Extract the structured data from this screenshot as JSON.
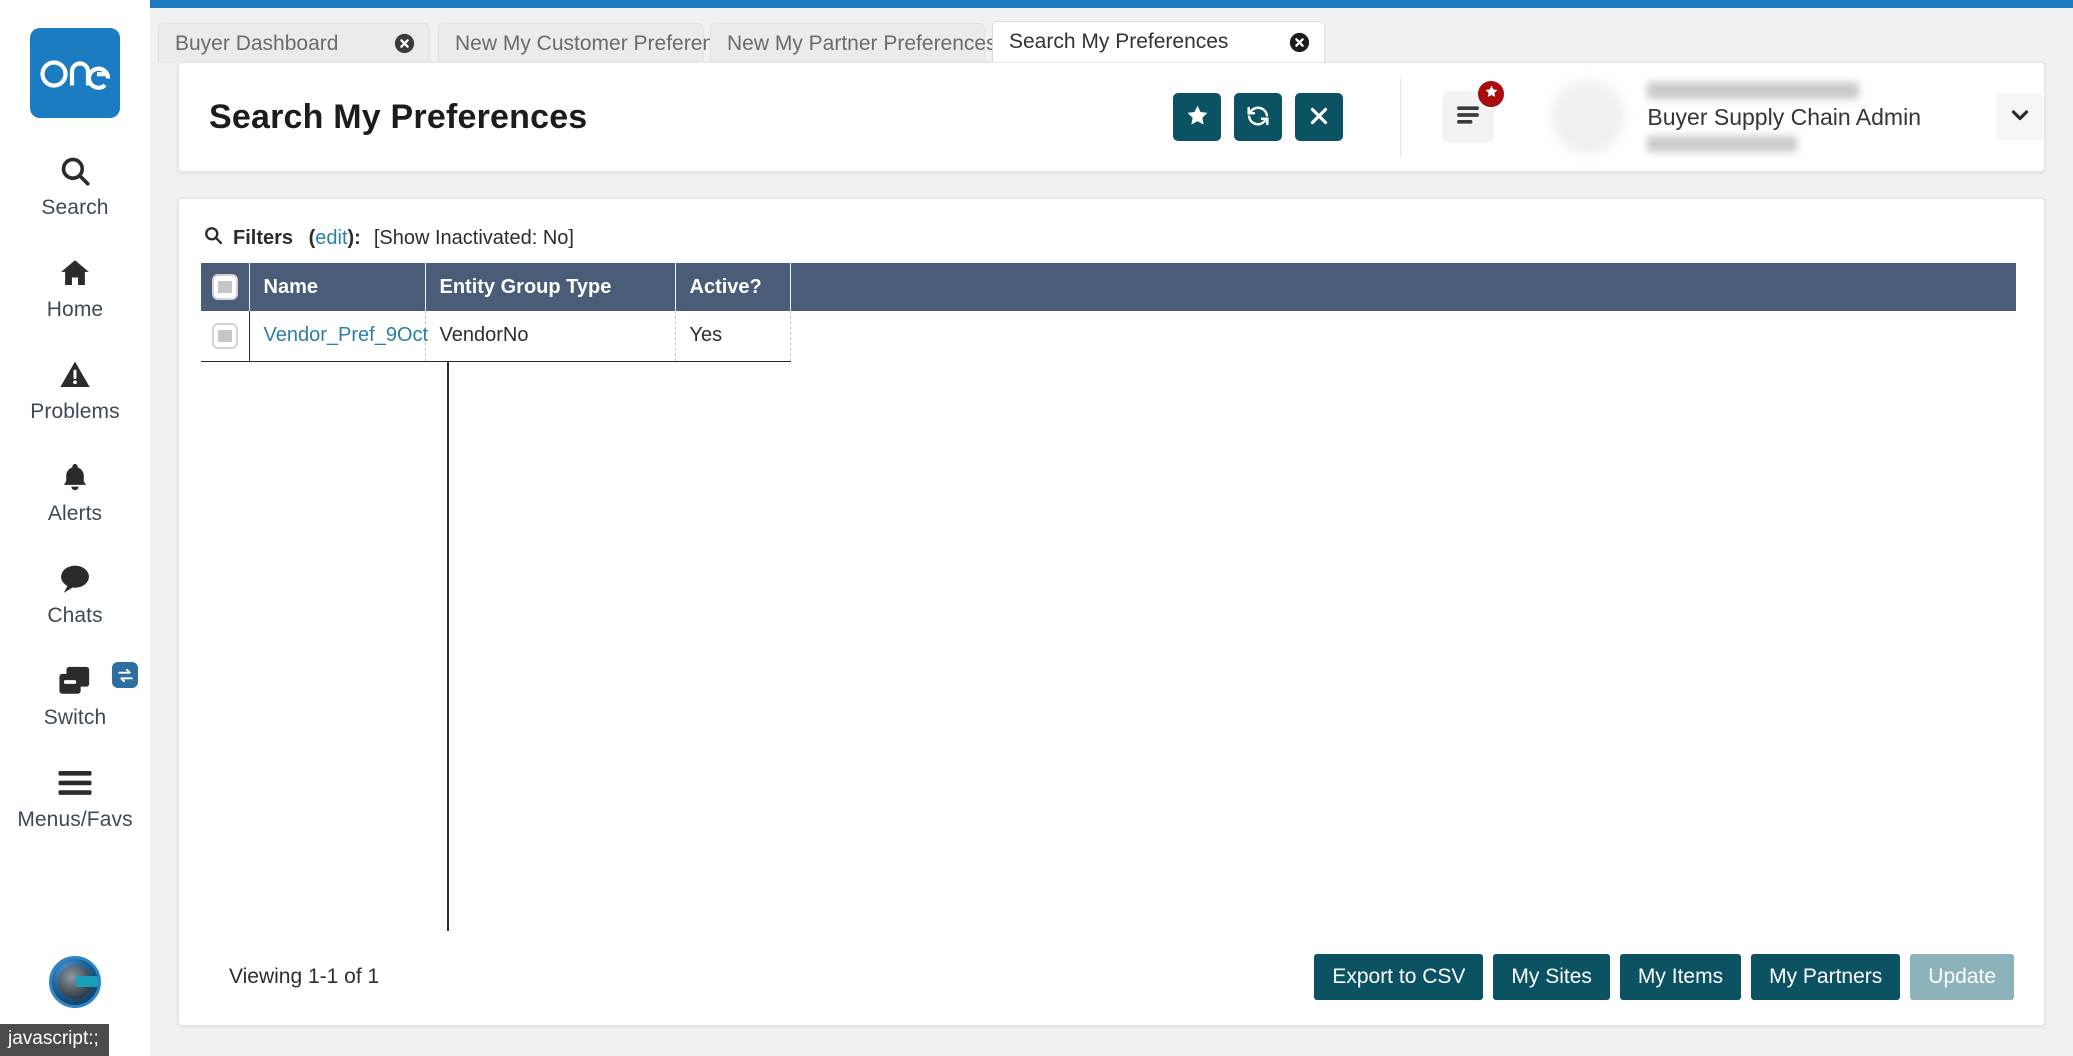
{
  "brand": {
    "logo_text": "one",
    "logo_color": "#1b7cc2",
    "accent_teal": "#0b5263",
    "table_header_color": "#495c78",
    "badge_red": "#a60e0e"
  },
  "sidebar": {
    "items": [
      {
        "label": "Search",
        "icon": "search-icon"
      },
      {
        "label": "Home",
        "icon": "home-icon"
      },
      {
        "label": "Problems",
        "icon": "warning-triangle-icon"
      },
      {
        "label": "Alerts",
        "icon": "bell-icon"
      },
      {
        "label": "Chats",
        "icon": "chat-bubble-icon"
      },
      {
        "label": "Switch",
        "icon": "windows-stack-icon"
      },
      {
        "label": "Menus/Favs",
        "icon": "hamburger-icon"
      }
    ],
    "switch_badge_icon": "swap-arrows-icon",
    "assistant_avatar_icon": "robot-avatar-icon",
    "status_tooltip": "javascript:;"
  },
  "tabs": [
    {
      "label": "Buyer Dashboard",
      "active": false,
      "close_icon": "close-circle-icon"
    },
    {
      "label": "New My Customer Preferences",
      "active": false,
      "close_icon": "close-circle-icon"
    },
    {
      "label": "New My Partner Preferences",
      "active": false,
      "close_icon": "close-circle-icon"
    },
    {
      "label": "Search My Preferences",
      "active": true,
      "close_icon": "close-circle-icon"
    }
  ],
  "header": {
    "title": "Search My Preferences",
    "actions": [
      {
        "name": "favorite-button",
        "icon": "star-icon"
      },
      {
        "name": "refresh-button",
        "icon": "refresh-icon"
      },
      {
        "name": "close-button",
        "icon": "x-icon"
      }
    ],
    "menu_favs_icon": "list-lines-icon",
    "menu_favs_badge_icon": "star-icon",
    "profile": {
      "role": "Buyer Supply Chain Admin",
      "caret_icon": "chevron-down-icon",
      "avatar_icon": "user-avatar"
    }
  },
  "filters": {
    "icon": "search-icon",
    "label": "Filters",
    "edit_label": "edit",
    "colon": ":",
    "state": "[Show Inactivated: No]"
  },
  "table": {
    "select_all_icon": "checkbox",
    "columns": [
      "",
      "Name",
      "Entity Group Type",
      "Active?",
      ""
    ],
    "rows": [
      {
        "name": "Vendor_Pref_9Oct",
        "entity_group_type": "VendorNo",
        "active": "Yes"
      }
    ]
  },
  "footer": {
    "viewing": "Viewing 1-1 of 1",
    "buttons": [
      {
        "label": "Export to CSV",
        "name": "export-to-csv-button",
        "disabled": false
      },
      {
        "label": "My Sites",
        "name": "my-sites-button",
        "disabled": false
      },
      {
        "label": "My Items",
        "name": "my-items-button",
        "disabled": false
      },
      {
        "label": "My Partners",
        "name": "my-partners-button",
        "disabled": false
      },
      {
        "label": "Update",
        "name": "update-button",
        "disabled": true
      }
    ]
  }
}
